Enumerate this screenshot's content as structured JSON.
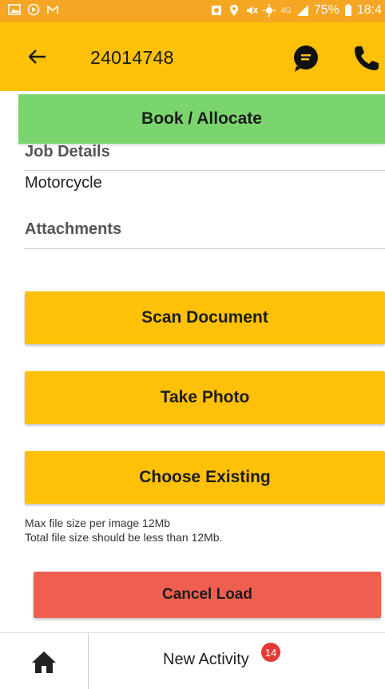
{
  "status_bar": {
    "battery": "75%",
    "time": "18:4",
    "network": "4G"
  },
  "app_bar": {
    "title": "24014748"
  },
  "actions": {
    "book_allocate": "Book / Allocate",
    "scan_document": "Scan Document",
    "take_photo": "Take Photo",
    "choose_existing": "Choose Existing",
    "cancel_load": "Cancel Load"
  },
  "job_details": {
    "header": "Job Details",
    "vehicle": "Motorcycle"
  },
  "attachments": {
    "header": "Attachments",
    "note_line1": "Max file size per image 12Mb",
    "note_line2": "Total file size should be less than 12Mb."
  },
  "bottom_nav": {
    "new_activity": "New Activity",
    "badge_count": "14"
  },
  "colors": {
    "app_bar": "#FFC107",
    "status_bar": "#F5A623",
    "book_button": "#7BD56F",
    "cancel_button": "#EF5F50",
    "badge": "#E53935"
  }
}
